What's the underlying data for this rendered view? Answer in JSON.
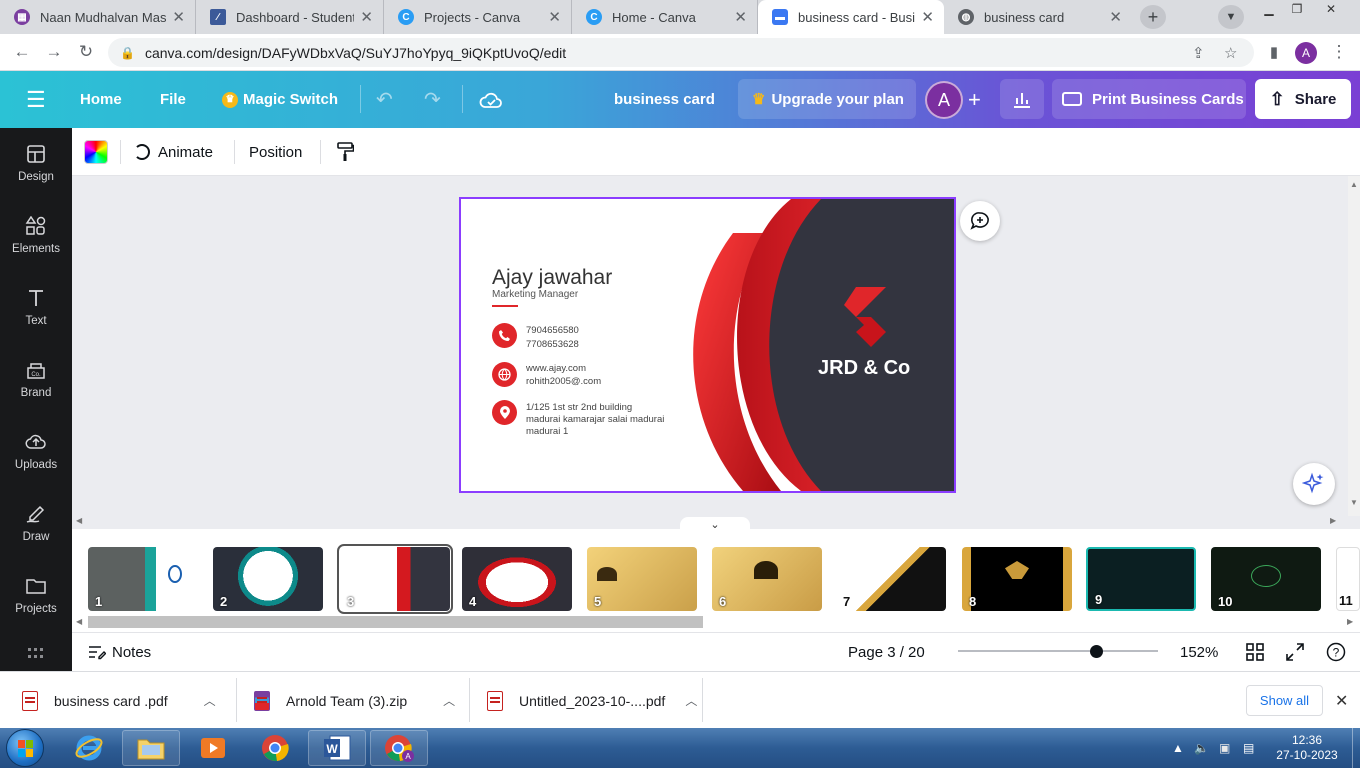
{
  "browser": {
    "tabs": [
      {
        "title": "Naan Mudhalvan Mass",
        "favicon_color": "#7b3fa0"
      },
      {
        "title": "Dashboard - Student",
        "favicon_color": "#3c5a99"
      },
      {
        "title": "Projects - Canva",
        "favicon_color": "#2a9df4"
      },
      {
        "title": "Home - Canva",
        "favicon_color": "#2a9df4"
      },
      {
        "title": "business card - Busines",
        "favicon_color": "#3b78f2",
        "active": true
      },
      {
        "title": "business card",
        "favicon_color": "#5f6368"
      }
    ],
    "url": "canva.com/design/DAFyWDbxVaQ/SuYJ7hoYpyq_9iQKptUvoQ/edit",
    "profile_initial": "A"
  },
  "header": {
    "home": "Home",
    "file": "File",
    "magic_switch": "Magic Switch",
    "doc_title": "business card",
    "upgrade": "Upgrade your plan",
    "avatar_initial": "A",
    "print": "Print Business Cards",
    "share": "Share"
  },
  "sidebar": {
    "items": [
      {
        "label": "Design",
        "icon": "design-icon"
      },
      {
        "label": "Elements",
        "icon": "elements-icon"
      },
      {
        "label": "Text",
        "icon": "text-icon"
      },
      {
        "label": "Brand",
        "icon": "brand-icon"
      },
      {
        "label": "Uploads",
        "icon": "uploads-icon"
      },
      {
        "label": "Draw",
        "icon": "draw-icon"
      },
      {
        "label": "Projects",
        "icon": "projects-icon"
      }
    ]
  },
  "toolbar": {
    "animate": "Animate",
    "position": "Position"
  },
  "card": {
    "name": "Ajay jawahar",
    "role": "Marketing Manager",
    "phone1": "7904656580",
    "phone2": "7708653628",
    "web": "www.ajay.com",
    "email": "rohith2005@.com",
    "addr1": "1/125 1st str 2nd building",
    "addr2": "madurai kamarajar salai madurai",
    "addr3": "madurai 1",
    "brand": "JRD & Co",
    "accent": "#e0262a",
    "dark": "#33343f"
  },
  "pages": {
    "thumbnails": [
      "1",
      "2",
      "3",
      "4",
      "5",
      "6",
      "7",
      "8",
      "9",
      "10",
      "11"
    ],
    "selected": 3
  },
  "bottombar": {
    "notes": "Notes",
    "page_indicator": "Page 3 / 20",
    "zoom": "152%"
  },
  "downloads": [
    {
      "name": "business card .pdf"
    },
    {
      "name": "Arnold Team (3).zip"
    },
    {
      "name": "Untitled_2023-10-....pdf"
    }
  ],
  "downloads_show_all": "Show all",
  "taskbar": {
    "time": "12:36",
    "date": "27-10-2023"
  }
}
